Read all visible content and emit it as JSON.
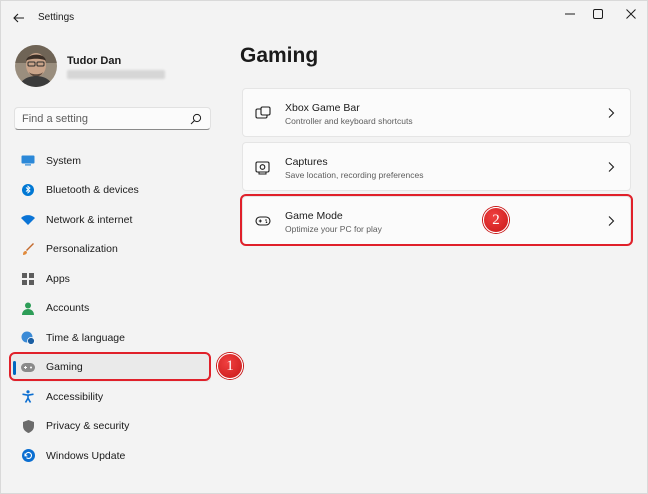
{
  "window": {
    "title": "Settings"
  },
  "profile": {
    "name": "Tudor Dan"
  },
  "search": {
    "placeholder": "Find a setting"
  },
  "sidebar": {
    "items": [
      {
        "label": "System",
        "icon": "system-icon",
        "color": "#0078d4"
      },
      {
        "label": "Bluetooth & devices",
        "icon": "bluetooth-icon",
        "color": "#0078d4"
      },
      {
        "label": "Network & internet",
        "icon": "wifi-icon",
        "color": "#0078d4"
      },
      {
        "label": "Personalization",
        "icon": "brush-icon",
        "color": "#c46b2d"
      },
      {
        "label": "Apps",
        "icon": "apps-icon",
        "color": "#5d5d5d"
      },
      {
        "label": "Accounts",
        "icon": "accounts-icon",
        "color": "#2d9d57"
      },
      {
        "label": "Time & language",
        "icon": "globe-clock-icon",
        "color": "#0078d4"
      },
      {
        "label": "Gaming",
        "icon": "controller-icon",
        "color": "#8a8a8a",
        "active": true
      },
      {
        "label": "Accessibility",
        "icon": "accessibility-icon",
        "color": "#0078d4"
      },
      {
        "label": "Privacy & security",
        "icon": "shield-icon",
        "color": "#6b6b6b"
      },
      {
        "label": "Windows Update",
        "icon": "update-icon",
        "color": "#0078d4"
      }
    ]
  },
  "main": {
    "title": "Gaming",
    "cards": [
      {
        "title": "Xbox Game Bar",
        "subtitle": "Controller and keyboard shortcuts",
        "icon": "game-bar-icon"
      },
      {
        "title": "Captures",
        "subtitle": "Save location, recording preferences",
        "icon": "captures-icon"
      },
      {
        "title": "Game Mode",
        "subtitle": "Optimize your PC for play",
        "icon": "game-mode-icon"
      }
    ]
  },
  "annotations": {
    "badge_1": "1",
    "badge_2": "2",
    "color": "#e0202a"
  },
  "colors": {
    "accent": "#0067c0",
    "background": "#f3f3f3",
    "card": "#fbfbfb"
  }
}
